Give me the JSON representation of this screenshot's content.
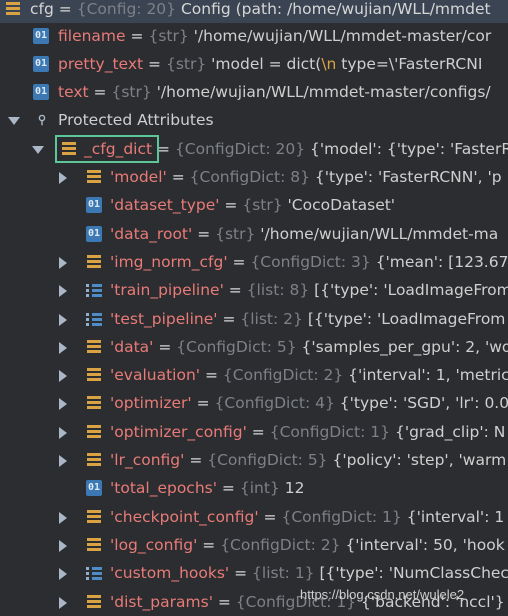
{
  "root": {
    "name": "cfg",
    "type": "{Config: 20}",
    "value": "Config (path: /home/wujian/WLL/mmdet"
  },
  "attributes": [
    {
      "name": "filename",
      "type": "{str}",
      "value": "'/home/wujian/WLL/mmdet-master/cor"
    },
    {
      "name": "pretty_text",
      "type": "{str}",
      "value_prefix": "'model = dict(",
      "value_escape": "\\n",
      "value_suffix": "   type=\\'FasterRCNI"
    },
    {
      "name": "text",
      "type": "{str}",
      "value": "'/home/wujian/WLL/mmdet-master/configs/"
    }
  ],
  "protected": {
    "label": "Protected Attributes",
    "cfg_dict": {
      "name": "_cfg_dict",
      "type": "{ConfigDict: 20}",
      "value": "{'model': {'type': 'FasterR"
    }
  },
  "items": [
    {
      "name": "'model'",
      "type": "{ConfigDict: 8}",
      "value": "{'type': 'FasterRCNN', 'p",
      "icon": "dict",
      "expandable": true
    },
    {
      "name": "'dataset_type'",
      "type": "{str}",
      "value": "'CocoDataset'",
      "icon": "01",
      "expandable": false
    },
    {
      "name": "'data_root'",
      "type": "{str}",
      "value": "'/home/wujian/WLL/mmdet-ma",
      "icon": "01",
      "expandable": false
    },
    {
      "name": "'img_norm_cfg'",
      "type": "{ConfigDict: 3}",
      "value": "{'mean': [123.67",
      "icon": "dict",
      "expandable": true
    },
    {
      "name": "'train_pipeline'",
      "type": "{list: 8}",
      "value": "[{'type': 'LoadImageFrom",
      "icon": "list",
      "expandable": true
    },
    {
      "name": "'test_pipeline'",
      "type": "{list: 2}",
      "value": "[{'type': 'LoadImageFrom",
      "icon": "list",
      "expandable": true
    },
    {
      "name": "'data'",
      "type": "{ConfigDict: 5}",
      "value": "{'samples_per_gpu': 2, 'wo",
      "icon": "dict",
      "expandable": true
    },
    {
      "name": "'evaluation'",
      "type": "{ConfigDict: 2}",
      "value": "{'interval': 1, 'metric",
      "icon": "dict",
      "expandable": true
    },
    {
      "name": "'optimizer'",
      "type": "{ConfigDict: 4}",
      "value": "{'type': 'SGD', 'lr': 0.0",
      "icon": "dict",
      "expandable": true
    },
    {
      "name": "'optimizer_config'",
      "type": "{ConfigDict: 1}",
      "value": "{'grad_clip': N",
      "icon": "dict",
      "expandable": true
    },
    {
      "name": "'lr_config'",
      "type": "{ConfigDict: 5}",
      "value": "{'policy': 'step', 'warm",
      "icon": "dict",
      "expandable": true
    },
    {
      "name": "'total_epochs'",
      "type": "{int}",
      "value": "12",
      "icon": "01",
      "expandable": false
    },
    {
      "name": "'checkpoint_config'",
      "type": "{ConfigDict: 1}",
      "value": "{'interval': 1",
      "icon": "dict",
      "expandable": true
    },
    {
      "name": "'log_config'",
      "type": "{ConfigDict: 2}",
      "value": "{'interval': 50, 'hook",
      "icon": "dict",
      "expandable": true
    },
    {
      "name": "'custom_hooks'",
      "type": "{list: 1}",
      "value": "[{'type': 'NumClassChec",
      "icon": "list",
      "expandable": true
    },
    {
      "name": "'dist_params'",
      "type": "{ConfigDict: 1}",
      "value": "{'backend': 'nccl'}",
      "icon": "dict",
      "expandable": true
    }
  ],
  "watermark": "https://blog.csdn.net/wulele2",
  "colors": {
    "background": "#2b2d30",
    "key": "#e87b78",
    "type": "#7e8087",
    "highlight": "#5ec79a"
  }
}
